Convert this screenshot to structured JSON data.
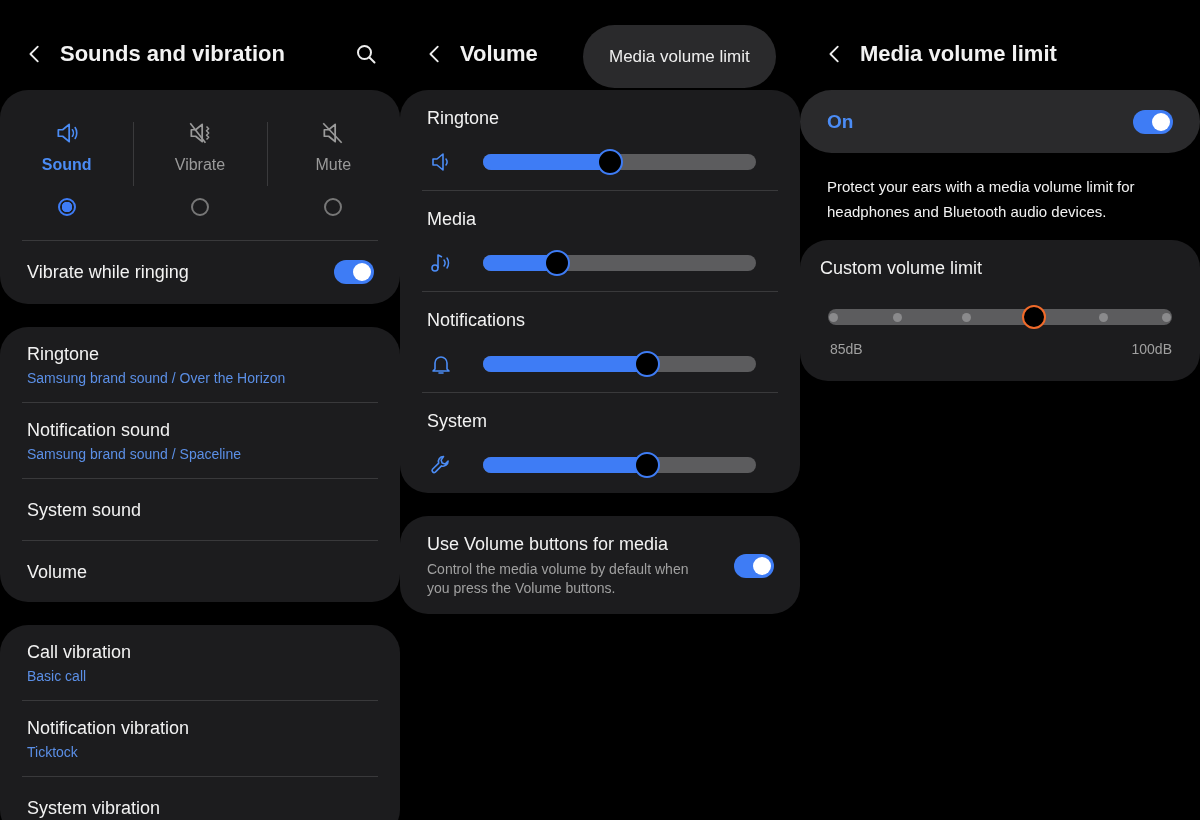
{
  "sounds_and_vibration": {
    "title": "Sounds and vibration",
    "modes": [
      {
        "kind": "sound",
        "label": "Sound",
        "selected": true
      },
      {
        "kind": "vibrate",
        "label": "Vibrate",
        "selected": false
      },
      {
        "kind": "mute",
        "label": "Mute",
        "selected": false
      }
    ],
    "vibrate_while_ringing": {
      "label": "Vibrate while ringing",
      "on": true
    },
    "groups": [
      [
        {
          "title": "Ringtone",
          "subtitle": "Samsung brand sound / Over the Horizon"
        },
        {
          "title": "Notification sound",
          "subtitle": "Samsung brand sound / Spaceline"
        },
        {
          "title": "System sound"
        },
        {
          "title": "Volume"
        }
      ],
      [
        {
          "title": "Call vibration",
          "subtitle": "Basic call"
        },
        {
          "title": "Notification vibration",
          "subtitle": "Ticktock"
        },
        {
          "title": "System vibration"
        }
      ]
    ]
  },
  "volume": {
    "title": "Volume",
    "tooltip": "Media volume limit",
    "sliders": [
      {
        "kind": "speaker",
        "label": "Ringtone",
        "level": 0.465
      },
      {
        "kind": "music",
        "label": "Media",
        "level": 0.27
      },
      {
        "kind": "bell",
        "label": "Notifications",
        "level": 0.6
      },
      {
        "kind": "wrench",
        "label": "System",
        "level": 0.6
      }
    ],
    "volume_buttons": {
      "title": "Use Volume buttons for media",
      "description": "Control the media volume by default when you press the Volume buttons.",
      "on": true
    }
  },
  "media_volume_limit": {
    "title": "Media volume limit",
    "master": {
      "label": "On",
      "on": true
    },
    "description": "Protect your ears with a media volume limit for headphones and Bluetooth audio devices.",
    "custom_limit": {
      "label": "Custom volume limit",
      "level": 0.6,
      "min_label": "85dB",
      "max_label": "100dB"
    }
  }
}
